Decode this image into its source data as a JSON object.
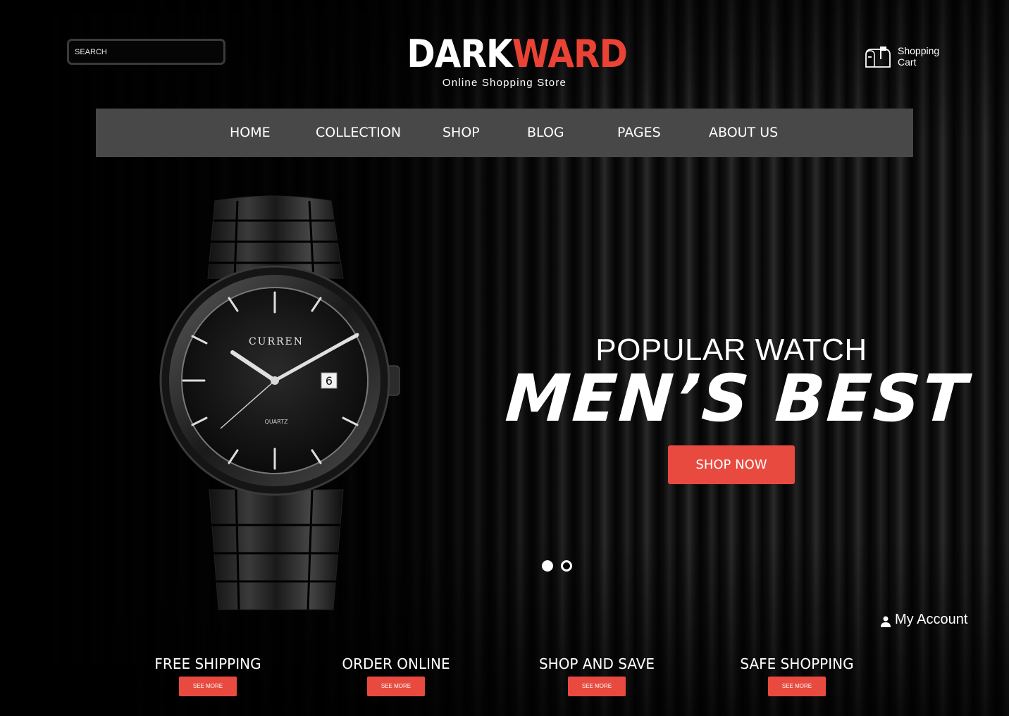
{
  "search": {
    "placeholder": "SEARCH"
  },
  "logo": {
    "title_white": "DARK",
    "title_red": "WARD",
    "subtitle": "Online Shopping Store"
  },
  "cart": {
    "line1": "Shopping",
    "line2": "Cart",
    "icon": "mailbox-cart-icon"
  },
  "nav": {
    "items": [
      "HOME",
      "COLLECTION",
      "SHOP",
      "BLOG",
      "PAGES",
      "ABOUT US"
    ]
  },
  "watch": {
    "brand": "CURREN",
    "model": "QUARTZ",
    "date": "6"
  },
  "hero": {
    "kicker": "POPULAR WATCH",
    "title": "MEN’S  BEST",
    "cta": "SHOP NOW"
  },
  "carousel": {
    "slides": 2,
    "active": 1
  },
  "account": {
    "label": "My Account",
    "icon": "user-icon"
  },
  "features": [
    {
      "title": "FREE SHIPPING",
      "button": "SEE MORE"
    },
    {
      "title": "ORDER ONLINE",
      "button": "SEE MORE"
    },
    {
      "title": "SHOP AND SAVE",
      "button": "SEE MORE"
    },
    {
      "title": "SAFE SHOPPING",
      "button": "SEE MORE"
    }
  ],
  "colors": {
    "accent": "#e94a3f",
    "nav_bg": "#484848",
    "background": "#000000"
  }
}
